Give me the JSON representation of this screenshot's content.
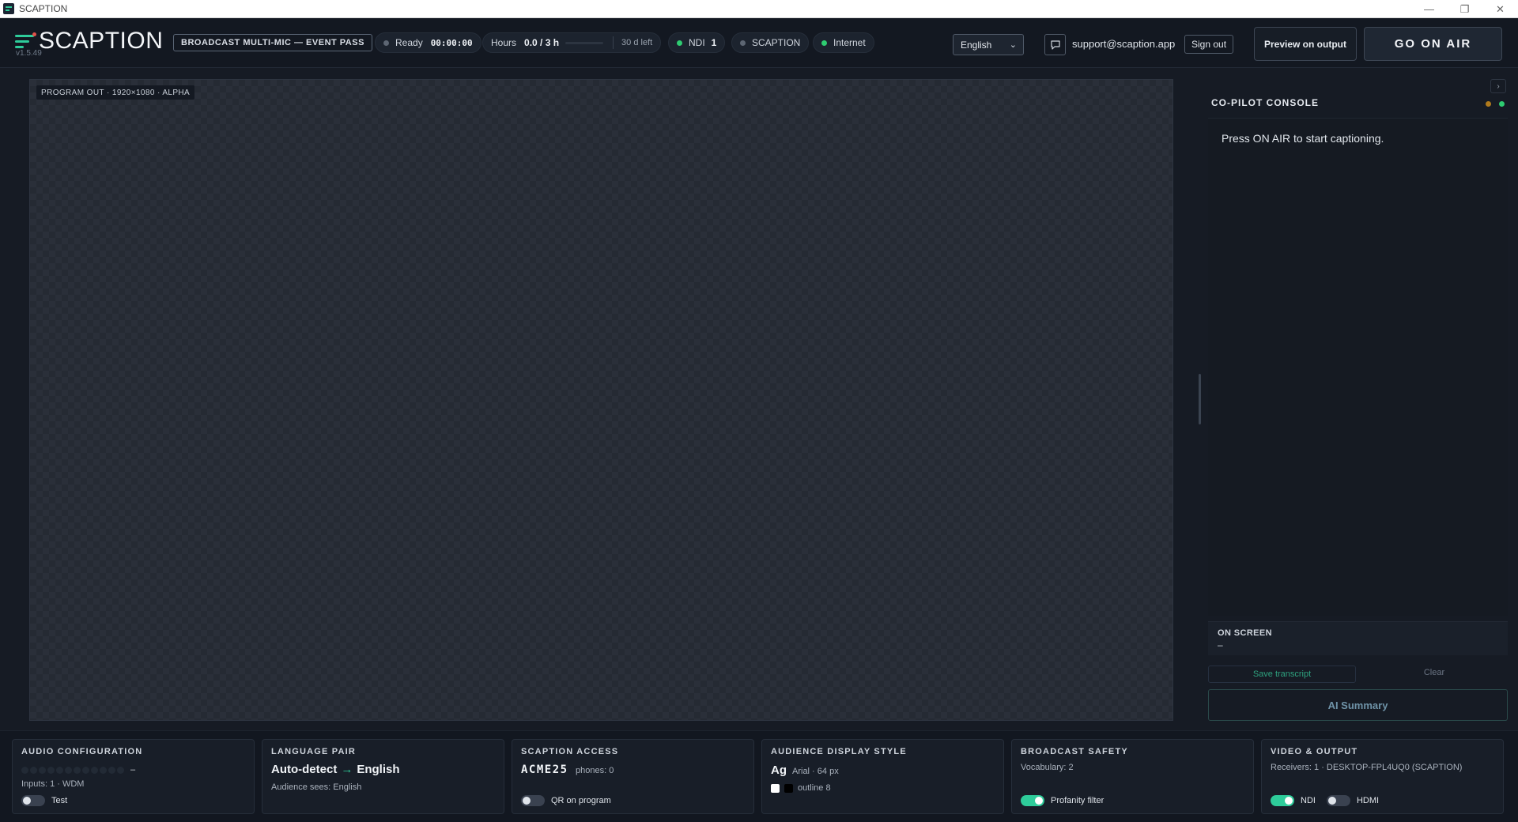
{
  "window": {
    "title": "SCAPTION",
    "controls": [
      "—",
      "❐",
      "✕"
    ]
  },
  "header": {
    "logo_text": "SCAPTION",
    "version": "v1.5.49",
    "plan_badge": "BROADCAST MULTI-MIC — EVENT PASS",
    "status": {
      "label": "Ready",
      "timer": "00:00:00"
    },
    "hours": {
      "label": "Hours",
      "value": "0.0 / 3 h",
      "used_fraction": 0.0,
      "left": "30 d left"
    },
    "ndi": {
      "label": "NDI",
      "count": "1"
    },
    "scaption_pill": "SCAPTION",
    "internet_pill": "Internet",
    "language": "English",
    "email": "support@scaption.app",
    "sign_out": "Sign out",
    "preview_button": "Preview on output",
    "on_air_button": "GO ON AIR"
  },
  "program": {
    "label": "PROGRAM OUT · 1920×1080 · ALPHA"
  },
  "copilot": {
    "collapse_glyph": "›",
    "title": "CO-PILOT CONSOLE",
    "status_colors": [
      "#b07a1c",
      "#2ecc71"
    ],
    "message": "Press ON AIR to start captioning.",
    "on_screen_label": "ON SCREEN",
    "on_screen_value": "–",
    "save_transcript": "Save transcript",
    "clear": "Clear",
    "ai_summary": "AI Summary"
  },
  "cards": {
    "audio": {
      "title": "AUDIO CONFIGURATION",
      "meter_value": "–",
      "inputs": "Inputs: 1 · WDM",
      "test_label": "Test",
      "test_on": false
    },
    "language": {
      "title": "LANGUAGE PAIR",
      "source": "Auto-detect",
      "arrow": "→",
      "target": "English",
      "audience": "Audience sees: English"
    },
    "access": {
      "title": "SCAPTION ACCESS",
      "code": "ACME25",
      "phones": "phones: 0",
      "qr_label": "QR on program",
      "qr_on": false
    },
    "display": {
      "title": "AUDIENCE DISPLAY STYLE",
      "sample": "Ag",
      "font": "Arial · 64 px",
      "text_color": "#ffffff",
      "outline_color": "#000000",
      "outline_label": "outline 8"
    },
    "safety": {
      "title": "BROADCAST SAFETY",
      "vocabulary": "Vocabulary: 2",
      "profanity_label": "Profanity filter",
      "profanity_on": true
    },
    "video": {
      "title": "VIDEO & OUTPUT",
      "receivers": "Receivers: 1 · DESKTOP-FPL4UQ0 (SCAPTION)",
      "ndi_label": "NDI",
      "ndi_on": true,
      "hdmi_label": "HDMI",
      "hdmi_on": false
    }
  },
  "colors": {
    "accent": "#2ecc9a",
    "ok": "#2ecc71",
    "idle": "#5d6673"
  }
}
